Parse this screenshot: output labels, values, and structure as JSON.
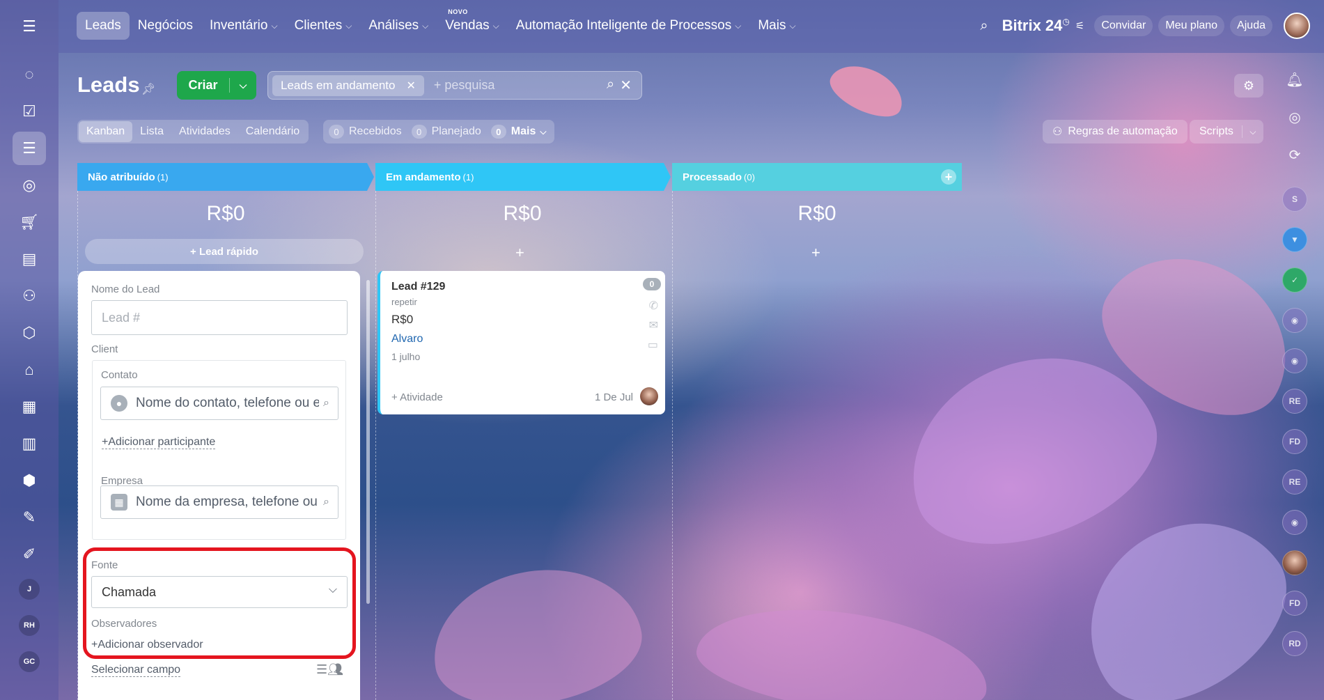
{
  "sidebar": {
    "icons": [
      "ring-icon",
      "task-check-icon",
      "funnel-icon",
      "target-icon",
      "cart-icon",
      "chat-card-icon",
      "robot-icon",
      "box-icon",
      "warehouse-icon",
      "calendar-list-icon",
      "bar-chart-icon",
      "shield-icon",
      "document-sign-icon",
      "pen-icon"
    ],
    "active_index": 2,
    "avatars": [
      "J",
      "RH",
      "GC"
    ]
  },
  "topnav": {
    "items": [
      {
        "label": "Leads",
        "active": true,
        "dropdown": false
      },
      {
        "label": "Negócios",
        "dropdown": false
      },
      {
        "label": "Inventário",
        "dropdown": true
      },
      {
        "label": "Clientes",
        "dropdown": true
      },
      {
        "label": "Análises",
        "dropdown": true
      },
      {
        "label": "Vendas",
        "dropdown": true,
        "badge": "NOVO"
      },
      {
        "label": "Automação Inteligente de Processos",
        "dropdown": true
      },
      {
        "label": "Mais",
        "dropdown": true
      }
    ],
    "brand": "Bitrix 24",
    "invite_label": "Convidar",
    "plan_label": "Meu plano",
    "help_label": "Ajuda"
  },
  "toolbar": {
    "title": "Leads",
    "create_label": "Criar",
    "filter_chip": "Leads em andamento",
    "search_placeholder": "+ pesquisa"
  },
  "views": {
    "items": [
      "Kanban",
      "Lista",
      "Atividades",
      "Calendário"
    ],
    "active_index": 0
  },
  "counters": {
    "received": {
      "count": "0",
      "label": "Recebidos"
    },
    "planned": {
      "count": "0",
      "label": "Planejado"
    },
    "more": {
      "count": "0",
      "label": "Mais"
    }
  },
  "automation_label": "Regras de automação",
  "scripts_label": "Scripts",
  "right_bar": {
    "circles": [
      "S",
      "",
      "",
      "",
      "",
      "RE",
      "FD",
      "RE",
      "",
      "",
      "FD",
      "RD"
    ]
  },
  "stages": [
    {
      "name": "Não atribuído",
      "count": "(1)",
      "sum": "R$0",
      "color": "#39a8ef"
    },
    {
      "name": "Em andamento",
      "count": "(1)",
      "sum": "R$0",
      "color": "#2fc6f6"
    },
    {
      "name": "Processado",
      "count": "(0)",
      "sum": "R$0",
      "color": "#55d0e0"
    }
  ],
  "quick_lead_label": "+ Lead rápido",
  "form": {
    "lead_name_label": "Nome do Lead",
    "lead_name_placeholder": "Lead #",
    "client_label": "Client",
    "contact_label": "Contato",
    "contact_placeholder": "Nome do contato, telefone ou e-mail",
    "add_participant": "Adicionar participante",
    "company_label": "Empresa",
    "company_placeholder": "Nome da empresa, telefone ou e-mail",
    "source_label": "Fonte",
    "source_value": "Chamada",
    "observers_label": "Observadores",
    "add_observer": "Adicionar observador",
    "select_field": "Selecionar campo"
  },
  "card": {
    "title": "Lead #129",
    "subtitle": "repetir",
    "price": "R$0",
    "contact": "Alvaro",
    "date": "1 julho",
    "counter": "0",
    "activity": "+ Atividade",
    "created": "1 De Jul"
  }
}
